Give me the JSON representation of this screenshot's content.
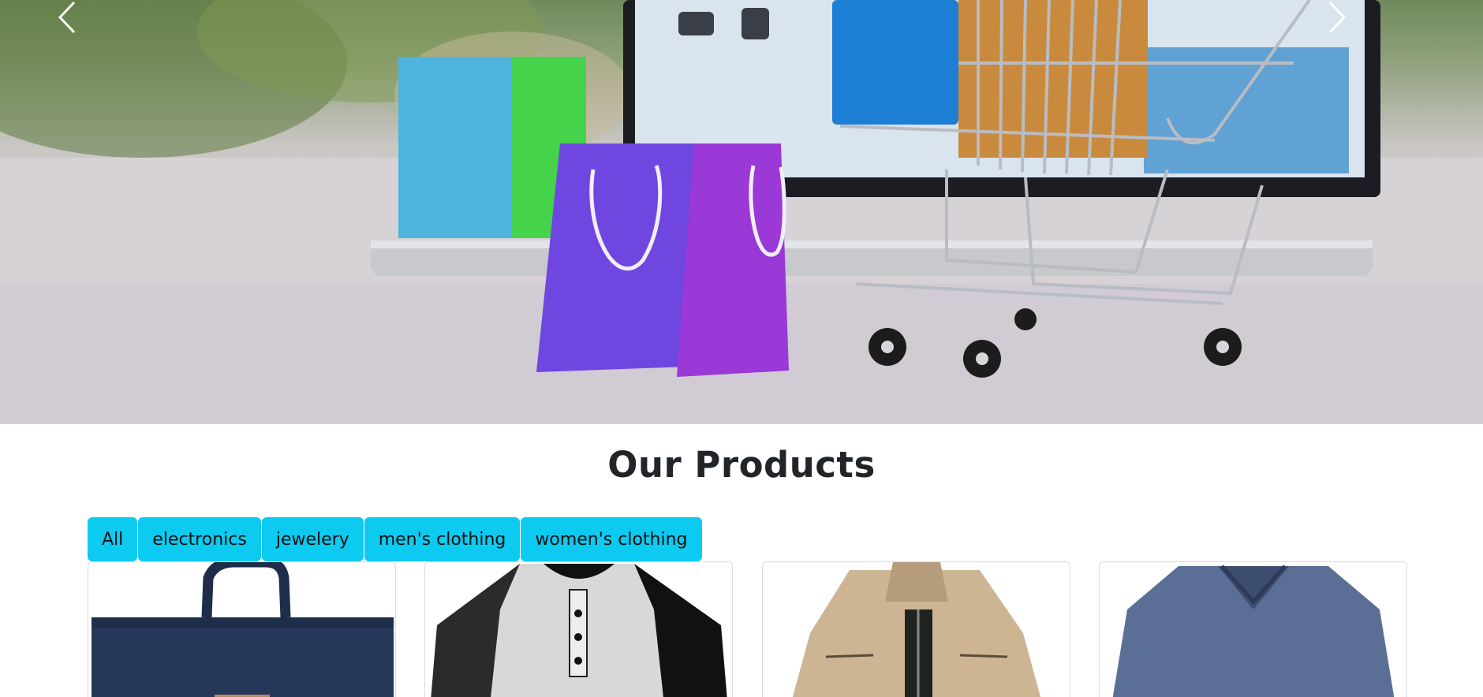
{
  "hero": {
    "prev_icon": "chevron-left-icon",
    "next_icon": "chevron-right-icon"
  },
  "section": {
    "title": "Our Products"
  },
  "filters": [
    {
      "label": "All"
    },
    {
      "label": "electronics"
    },
    {
      "label": "jewelery"
    },
    {
      "label": "men's clothing"
    },
    {
      "label": "women's clothing"
    }
  ],
  "colors": {
    "accent": "#0dcaf0",
    "text": "#212529"
  },
  "products": [
    {
      "image": "backpack"
    },
    {
      "image": "raglan-henley-shirt"
    },
    {
      "image": "beige-jacket"
    },
    {
      "image": "blue-v-neck-tshirt"
    }
  ]
}
